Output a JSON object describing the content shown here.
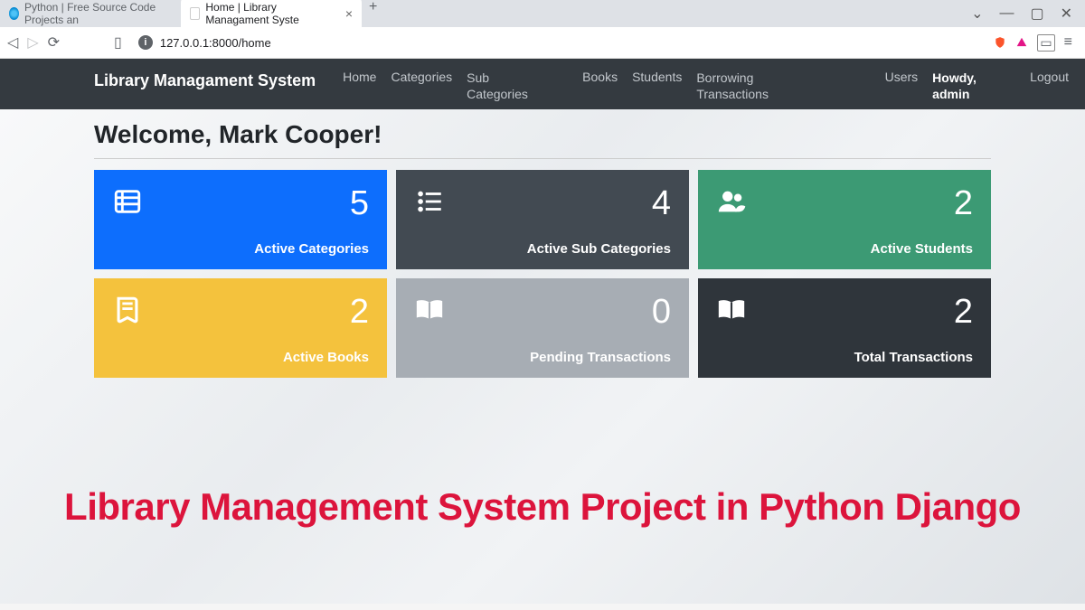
{
  "browser": {
    "tabs": [
      {
        "title": "Python | Free Source Code Projects an"
      },
      {
        "title": "Home | Library Managament Syste"
      }
    ],
    "url": "127.0.0.1:8000/home"
  },
  "navbar": {
    "brand": "Library Managament System",
    "links": {
      "home": "Home",
      "categories": "Categories",
      "subcategories": "Sub Categories",
      "books": "Books",
      "students": "Students",
      "borrowing": "Borrowing Transactions",
      "users": "Users",
      "howdy": "Howdy, admin",
      "logout": "Logout"
    }
  },
  "page": {
    "welcome": "Welcome, Mark Cooper!"
  },
  "cards": {
    "activeCategories": {
      "value": "5",
      "label": "Active Categories"
    },
    "activeSubCategories": {
      "value": "4",
      "label": "Active Sub Categories"
    },
    "activeStudents": {
      "value": "2",
      "label": "Active Students"
    },
    "activeBooks": {
      "value": "2",
      "label": "Active Books"
    },
    "pendingTransactions": {
      "value": "0",
      "label": "Pending Transactions"
    },
    "totalTransactions": {
      "value": "2",
      "label": "Total Transactions"
    }
  },
  "overlay": "Library Management System Project in Python Django"
}
